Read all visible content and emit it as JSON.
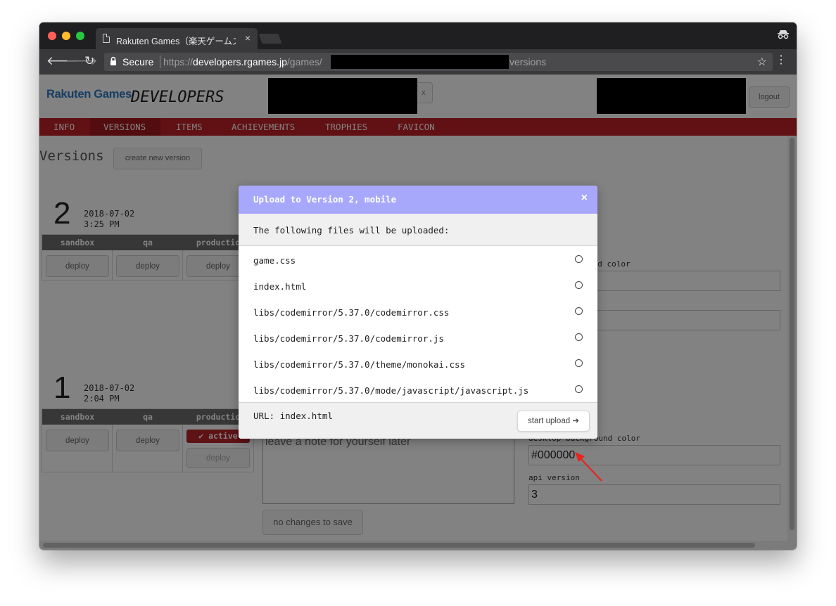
{
  "browser": {
    "tab_title": "Rakuten Games（楽天ゲームズ",
    "tab_close": "×",
    "secure_label": "Secure",
    "url_prefix": "https://",
    "url_host": "developers.rgames.jp",
    "url_path": "/games/",
    "url_tail": "versions",
    "icons": [
      "back-arrow-icon",
      "forward-arrow-icon",
      "reload-icon",
      "lock-icon",
      "star-icon",
      "menu-dots-icon",
      "incognito-icon",
      "page-icon"
    ]
  },
  "header": {
    "logo_brand": "Rakuten Games",
    "logo_sub": "DEVELOPERS",
    "close_x": "x",
    "logout_label": "logout"
  },
  "nav": {
    "items": [
      {
        "label": "INFO"
      },
      {
        "label": "VERSIONS"
      },
      {
        "label": "ITEMS"
      },
      {
        "label": "ACHIEVEMENTS"
      },
      {
        "label": "TROPHIES"
      },
      {
        "label": "FAVICON"
      }
    ],
    "active": "VERSIONS",
    "color": "#bf2128"
  },
  "page": {
    "title": "Versions",
    "create_button": "create new version"
  },
  "versions": [
    {
      "number": "2",
      "date": "2018-07-02",
      "time": "3:25 PM",
      "envs": [
        {
          "name": "sandbox",
          "deploy": "deploy"
        },
        {
          "name": "qa",
          "deploy": "deploy"
        },
        {
          "name": "productio",
          "deploy": "deploy"
        }
      ]
    },
    {
      "number": "1",
      "date": "2018-07-02",
      "time": "2:04 PM",
      "envs": [
        {
          "name": "sandbox",
          "deploy": "deploy"
        },
        {
          "name": "qa",
          "deploy": "deploy"
        },
        {
          "name": "productio",
          "deploy": "deploy",
          "badge": "active"
        }
      ]
    }
  ],
  "form_v2": {
    "bg_label_partial": "und color"
  },
  "form_v1": {
    "note_placeholder": "leave a note for yourself later",
    "save_label": "no changes to save",
    "bg_label": "desktop background color",
    "bg_value": "#000000",
    "api_label": "api version",
    "api_value": "3"
  },
  "modal": {
    "title": "Upload to Version 2, mobile",
    "close": "×",
    "intro": "The following files will be uploaded:",
    "files": [
      "game.css",
      "index.html",
      "libs/codemirror/5.37.0/codemirror.css",
      "libs/codemirror/5.37.0/codemirror.js",
      "libs/codemirror/5.37.0/theme/monokai.css",
      "libs/codemirror/5.37.0/mode/javascript/javascript.js"
    ],
    "url_label": "URL: index.html",
    "start_label": "start upload",
    "start_arrow": "➔",
    "header_color": "#a7a8fb"
  },
  "annotation": {
    "arrow_color": "#e8231f"
  }
}
